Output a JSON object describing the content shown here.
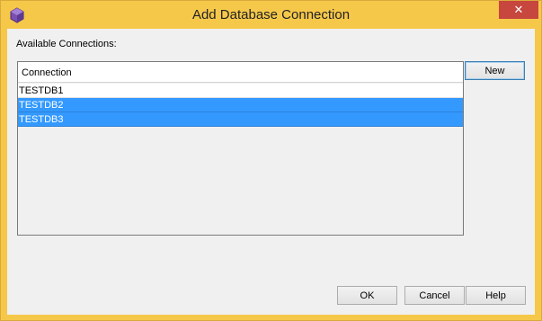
{
  "window": {
    "title": "Add Database Connection",
    "app_icon": "cube-icon",
    "close_glyph": "✕",
    "accent_color": "#f6c84a",
    "close_color": "#c7463d"
  },
  "connections": {
    "label": "Available Connections:",
    "column_header": "Connection",
    "rows": [
      {
        "name": "TESTDB1",
        "selected": false
      },
      {
        "name": "TESTDB2",
        "selected": true
      },
      {
        "name": "TESTDB3",
        "selected": true
      }
    ],
    "selection_color": "#3399ff"
  },
  "buttons": {
    "new": "New",
    "ok": "OK",
    "cancel": "Cancel",
    "help": "Help"
  }
}
